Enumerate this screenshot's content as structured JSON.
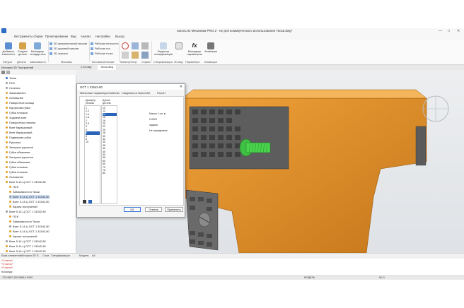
{
  "window": {
    "title": "nanoCAD Механика PRO 2 - не для коммерческого использования Тиски.dwg*",
    "controls": [
      "—",
      "□",
      "✕"
    ]
  },
  "menu": [
    "Инструменты сборки",
    "Проектирование",
    "Вид",
    "Анализ",
    "Настройки",
    "Выход"
  ],
  "ribbon": {
    "buttons": [
      {
        "label": "Добавить компонент",
        "icon": "add-component-icon"
      },
      {
        "label": "Создать деталь",
        "icon": "create-part-icon"
      },
      {
        "label": "Менеджер стандартных",
        "icon": "standard-manager-icon"
      }
    ],
    "small_items": [
      "3D-прямоугольный массив",
      "3D-круговой массив",
      "3D-зеркало",
      "Рабочая плоскость",
      "Рабочая ось",
      "Рабочая точка"
    ],
    "right_buttons": [
      {
        "label": "Редактор спецификации",
        "icon": "spec-editor-icon"
      },
      {
        "label": "Менеджер параметров",
        "icon": "fx-icon",
        "glyph": "fx"
      },
      {
        "label": "Анимация",
        "icon": "animation-icon"
      }
    ],
    "groups": [
      "Фигуры",
      "Детали",
      "Зависимость",
      "Массивы",
      "Вспомогательные",
      "Манипулятор",
      "Сервис",
      "Спецификация",
      "2D-вид",
      "Параметры",
      "Анимация"
    ]
  },
  "leftpanel": {
    "header": "История 3D Построений",
    "tree": [
      "Тиски",
      "ПСК",
      "Сечения",
      "Зависимости",
      "Основание",
      "Поворотное кольцо",
      "Корпусная губка",
      "Губка плоская",
      "Ходовой винт",
      "Поворотная станина",
      "Винт барашковый",
      "Винт барашковый",
      "Подвижная губка",
      "Рукоятка",
      "Заглушка рукоятки",
      "Губка обжимная",
      "Заглушка рукоятки",
      "Губка обжимная",
      "Губка плоская",
      "Губка плоская",
      "Основание",
      "Винт 5-14-Ц ОСТ 1 31542-80",
      "ПСК",
      "Зависимости в Тиски",
      "Винт 5-14-Ц ОСТ 1 31542-80",
      "Винт 5-14-Ц ОСТ 1 31542-80",
      "Каркас построений",
      "Винт 5-14-Ц ОСТ 1 31542-80",
      "ПСК",
      "Зависимости в Тиски",
      "Винт 5-14-Ц ОСТ 1 31542-80",
      "Винт 5-14-Ц ОСТ 1 31542-80",
      "Каркас построений",
      "Винт 5-14-Ц ОСТ 1 31542-80",
      "Винт 5-14-Ц ОСТ 1 31542-80",
      "Винт 5-14-Ц ОСТ 1 31542-80"
    ]
  },
  "doc_tabs": [
    "2,10.dwg",
    "Тиски.dwg"
  ],
  "dialog": {
    "title": "ОСТ 1 31542-80",
    "close": "✕",
    "tabs": [
      "Табличные параметры",
      "Свойства",
      "Сведения из NanoCAD",
      "Расчёт"
    ],
    "col1_header": "Диаметр резьбы",
    "col2_header": "Длина детали",
    "col1_values": [
      "1",
      "1.2",
      "1.4",
      "1.6",
      "2",
      "2.5",
      "3",
      "4",
      "5",
      "6",
      "8",
      "10"
    ],
    "col1_selected": "5",
    "col2_values": [
      "10",
      "12",
      "14",
      "16",
      "18",
      "20",
      "22",
      "25",
      "28",
      "30",
      "32",
      "35",
      "38",
      "40",
      "45",
      "50",
      "55",
      "60",
      "65",
      "70",
      "75",
      "80"
    ],
    "col2_selected": "14",
    "fields": [
      "Масса 1 шт. кг",
      "0.0022",
      "задана",
      "Не определена"
    ],
    "buttons": [
      "OK",
      "Отмена",
      "Применить"
    ]
  },
  "bottom_tabs": [
    "База элементов",
    "История 3D П...",
    "Слои",
    "Спецификация"
  ],
  "view_tabs": [
    "Модель",
    "A4"
  ],
  "command_lines": [
    "Команда:",
    "*Отмена*",
    "*Отмена*",
    "*Отмена*"
  ],
  "status": {
    "coords": "-175.9587,150.0586,0.0000",
    "mode": "МОДЕЛЬ",
    "scale": "M1:1"
  },
  "colors": {
    "part": "#e8951e",
    "part_dark": "#b86a10",
    "steel": "#6d6d6d",
    "highlight": "#4cd44f",
    "selection": "#2a64b8"
  }
}
